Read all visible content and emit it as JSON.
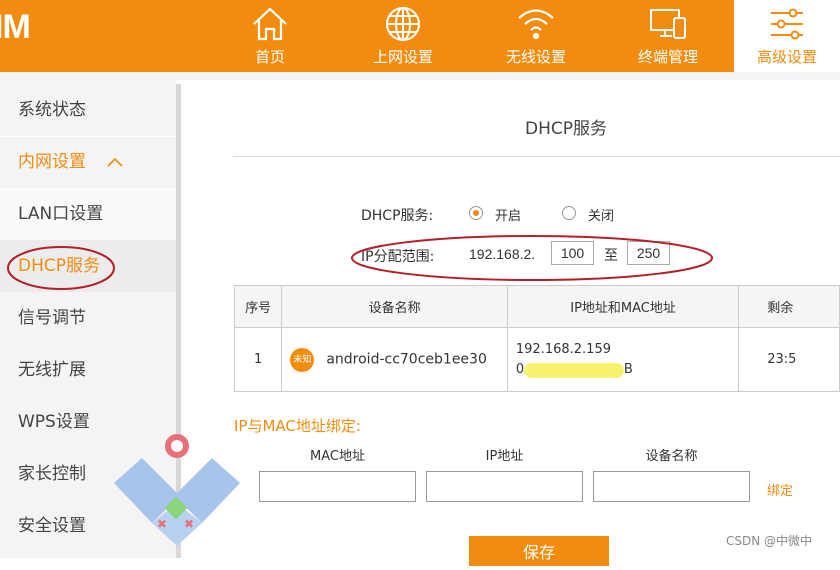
{
  "header": {
    "logo_text": "IM",
    "nav": [
      {
        "label": "首页",
        "icon": "home-icon"
      },
      {
        "label": "上网设置",
        "icon": "globe-icon"
      },
      {
        "label": "无线设置",
        "icon": "wifi-icon"
      },
      {
        "label": "终端管理",
        "icon": "devices-icon"
      },
      {
        "label": "高级设置",
        "icon": "sliders-icon"
      }
    ],
    "active_nav": "高级设置"
  },
  "sidebar": {
    "items": [
      {
        "label": "系统状态"
      },
      {
        "label": "内网设置",
        "expand_glyph": "^"
      },
      {
        "label": "LAN口设置"
      },
      {
        "label": "DHCP服务"
      },
      {
        "label": "信号调节"
      },
      {
        "label": "无线扩展"
      },
      {
        "label": "WPS设置"
      },
      {
        "label": "家长控制"
      },
      {
        "label": "安全设置"
      }
    ],
    "selected": "DHCP服务"
  },
  "main": {
    "title": "DHCP服务",
    "dhcp": {
      "label": "DHCP服务:",
      "on_label": "开启",
      "off_label": "关闭",
      "selected": "开启"
    },
    "range": {
      "label": "IP分配范围:",
      "prefix": "192.168.2.",
      "start": "100",
      "to_label": "至",
      "end": "250"
    },
    "table": {
      "headers": [
        "序号",
        "设备名称",
        "IP地址和MAC地址",
        "剩余"
      ],
      "rows": [
        {
          "index": "1",
          "badge": "未知",
          "name": "android-cc70ceb1ee30",
          "ip": "192.168.2.159",
          "mac_start": "0",
          "mac_end": "B",
          "lease": "23:5"
        }
      ]
    },
    "binding": {
      "title": "IP与MAC地址绑定:",
      "headers": [
        "MAC地址",
        "IP地址",
        "设备名称"
      ],
      "bind_label": "绑定"
    },
    "save_label": "保存"
  },
  "watermark": "CSDN @中微中",
  "colors": {
    "accent": "#f28c10",
    "annotation_red": "#b3202a",
    "highlight": "#f7f26b"
  }
}
